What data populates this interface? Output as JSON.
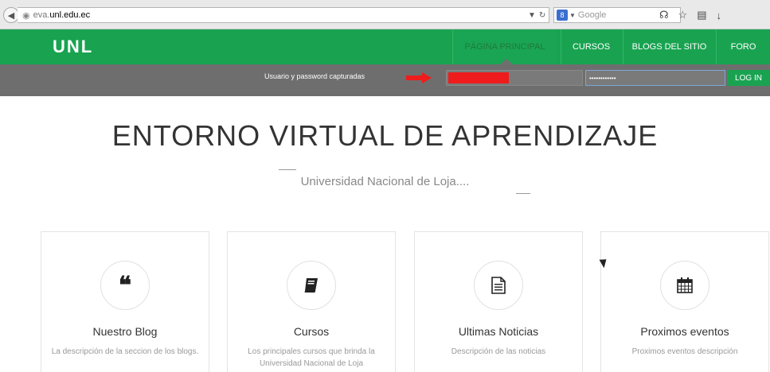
{
  "browser": {
    "url_prefix": "eva.",
    "url_host": "unl.edu.ec",
    "search_placeholder": "Google"
  },
  "nav": {
    "logo": "UNL",
    "items": [
      {
        "label": "PÁGINA PRINCIPAL",
        "active": true
      },
      {
        "label": "CURSOS",
        "active": false
      },
      {
        "label": "BLOGS DEL SITIO",
        "active": false
      },
      {
        "label": "FORO",
        "active": false
      }
    ]
  },
  "login": {
    "captured_text": "Usuario y password capturadas",
    "password_mask": "••••••••••••",
    "button": "LOG IN",
    "redaction_color": "#ee1c1c"
  },
  "hero": {
    "title": "ENTORNO VIRTUAL DE APRENDIZAJE",
    "subtitle": "Universidad Nacional de Loja...."
  },
  "cards": [
    {
      "icon": "quote-icon",
      "title": "Nuestro Blog",
      "desc": "La descripción de la seccion de los blogs."
    },
    {
      "icon": "book-icon",
      "title": "Cursos",
      "desc": "Los principales cursos que brinda la Universidad Nacional de Loja"
    },
    {
      "icon": "document-icon",
      "title": "Ultimas Noticias",
      "desc": "Descripción de las noticias"
    },
    {
      "icon": "calendar-icon",
      "title": "Proximos eventos",
      "desc": "Proximos eventos descripción"
    }
  ],
  "colors": {
    "brand_green": "#19a351",
    "login_bar": "#6e6e6e"
  }
}
